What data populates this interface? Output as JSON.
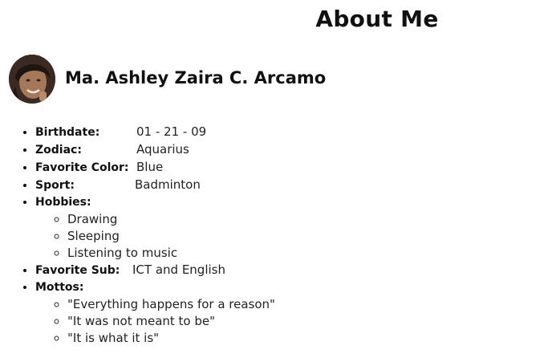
{
  "header": {
    "title": "About Me"
  },
  "profile": {
    "name": "Ma. Ashley Zaira C. Arcamo"
  },
  "details": {
    "birthdate": {
      "label": "Birthdate:",
      "value": "01 - 21 - 09"
    },
    "zodiac": {
      "label": "Zodiac:",
      "value": "Aquarius"
    },
    "favorite_color": {
      "label": "Favorite Color:",
      "value": "Blue"
    },
    "sport": {
      "label": "Sport:",
      "value": "Badminton"
    },
    "hobbies": {
      "label": "Hobbies:",
      "items": [
        "Drawing",
        "Sleeping",
        "Listening to music"
      ]
    },
    "favorite_sub": {
      "label": "Favorite Sub:",
      "value": "ICT and English"
    },
    "mottos": {
      "label": "Mottos:",
      "items": [
        "\"Everything happens for a reason\"",
        "\"It was not meant to be\"",
        "\"It is what it is\""
      ]
    }
  }
}
